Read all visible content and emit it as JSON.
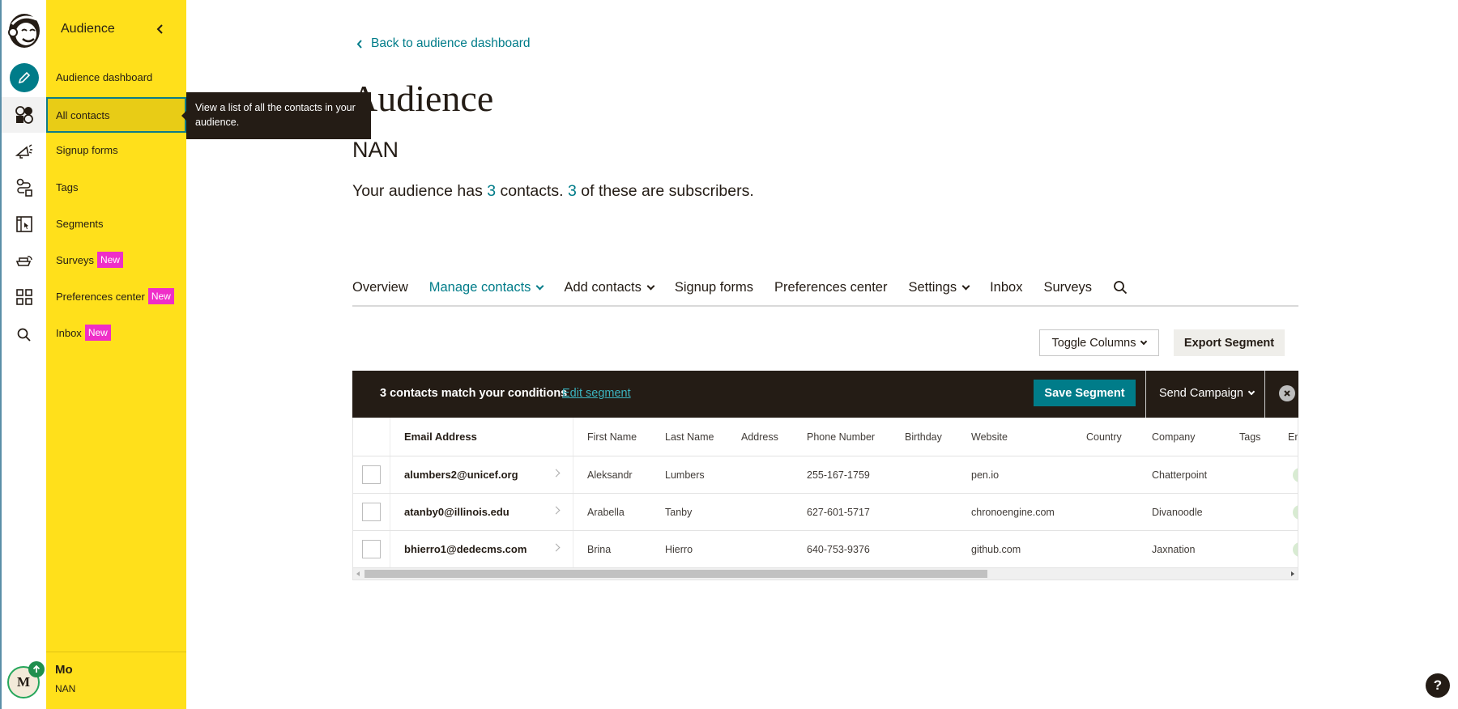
{
  "rail": {
    "icons": [
      "mailchimp-logo",
      "create-pencil-icon",
      "audience-icon",
      "campaigns-megaphone-icon",
      "automations-icon",
      "website-icon",
      "content-studio-icon",
      "integrations-grid-icon",
      "search-icon"
    ],
    "avatar_initial": "M",
    "colors": {
      "create": "#007c89",
      "avatar_ring": "#26a65b"
    }
  },
  "nav": {
    "title": "Audience",
    "items": [
      {
        "label": "Audience dashboard",
        "badge": null
      },
      {
        "label": "All contacts",
        "badge": null,
        "active": true
      },
      {
        "label": "Signup forms",
        "badge": null
      },
      {
        "label": "Tags",
        "badge": null
      },
      {
        "label": "Segments",
        "badge": null
      },
      {
        "label": "Surveys",
        "badge": "New"
      },
      {
        "label": "Preferences center",
        "badge": "New"
      },
      {
        "label": "Inbox",
        "badge": "New"
      }
    ],
    "user": {
      "name": "Mo",
      "account": "NAN"
    },
    "colors": {
      "background": "#ffe01b",
      "badge": "#ef2ec8"
    }
  },
  "tooltip": {
    "text": "View a list of all the contacts in your audience."
  },
  "main": {
    "back_link": "Back to audience dashboard",
    "title": "Audience",
    "audience_name": "NAN",
    "summary": {
      "prefix": "Your audience has ",
      "contacts": "3",
      "middle": " contacts. ",
      "subscribers": "3",
      "suffix": " of these are subscribers."
    },
    "tabs": [
      {
        "label": "Overview",
        "dropdown": false
      },
      {
        "label": "Manage contacts",
        "dropdown": true,
        "active": true
      },
      {
        "label": "Add contacts",
        "dropdown": true
      },
      {
        "label": "Signup forms",
        "dropdown": false
      },
      {
        "label": "Preferences center",
        "dropdown": false
      },
      {
        "label": "Settings",
        "dropdown": true
      },
      {
        "label": "Inbox",
        "dropdown": false
      },
      {
        "label": "Surveys",
        "dropdown": false
      }
    ],
    "toggle_columns": "Toggle Columns",
    "export_segment": "Export Segment",
    "segment_bar": {
      "message": "3 contacts match your conditions",
      "edit_link": "Edit segment",
      "save": "Save Segment",
      "send_campaign": "Send Campaign"
    },
    "table": {
      "columns": [
        "Email Address",
        "First Name",
        "Last Name",
        "Address",
        "Phone Number",
        "Birthday",
        "Website",
        "Country",
        "Company",
        "Tags",
        "Em"
      ],
      "rows": [
        {
          "email": "alumbers2@unicef.org",
          "first": "Aleksandr",
          "last": "Lumbers",
          "address": "",
          "phone": "255-167-1759",
          "birthday": "",
          "website": "pen.io",
          "country": "",
          "company": "Chatterpoint",
          "tags": ""
        },
        {
          "email": "atanby0@illinois.edu",
          "first": "Arabella",
          "last": "Tanby",
          "address": "",
          "phone": "627-601-5717",
          "birthday": "",
          "website": "chronoengine.com",
          "country": "",
          "company": "Divanoodle",
          "tags": ""
        },
        {
          "email": "bhierro1@dedecms.com",
          "first": "Brina",
          "last": "Hierro",
          "address": "",
          "phone": "640-753-9376",
          "birthday": "",
          "website": "github.com",
          "country": "",
          "company": "Jaxnation",
          "tags": ""
        }
      ]
    },
    "colors": {
      "accent": "#007c89",
      "dark": "#241c15"
    }
  },
  "help": {
    "label": "?"
  }
}
